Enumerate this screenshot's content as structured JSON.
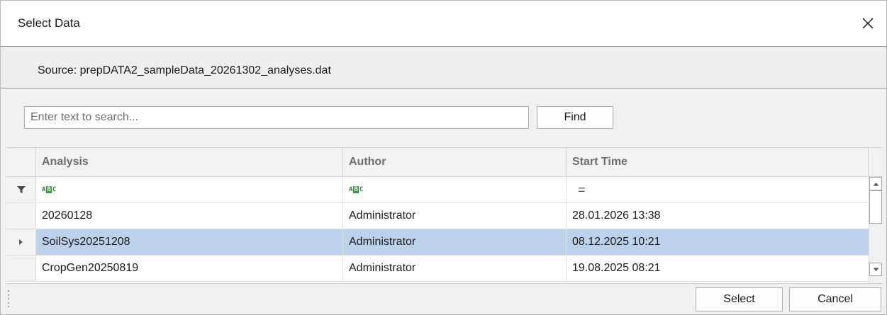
{
  "window": {
    "title": "Select Data",
    "close_icon": "close-icon"
  },
  "source": {
    "label": "Source: prepDATA2_sampleData_20261302_analyses.dat"
  },
  "search": {
    "placeholder": "Enter text to search...",
    "value": "",
    "find_label": "Find"
  },
  "grid": {
    "columns": [
      "Analysis",
      "Author",
      "Start Time"
    ],
    "filter": {
      "text_filter_icon": "abc-text-filter-icon",
      "text_icon_left": "A",
      "text_icon_mid": "B",
      "text_icon_right": "C",
      "equals_symbol": "="
    },
    "rows": [
      {
        "analysis": "20260128",
        "author": "Administrator",
        "start_time": "28.01.2026 13:38"
      },
      {
        "analysis": "SoilSys20251208",
        "author": "Administrator",
        "start_time": "08.12.2025 10:21"
      },
      {
        "analysis": "CropGen20250819",
        "author": "Administrator",
        "start_time": "19.08.2025 08:21"
      }
    ],
    "selected_row": 1,
    "selection_color": "#bdd2ea"
  },
  "footer": {
    "select_label": "Select",
    "cancel_label": "Cancel"
  }
}
